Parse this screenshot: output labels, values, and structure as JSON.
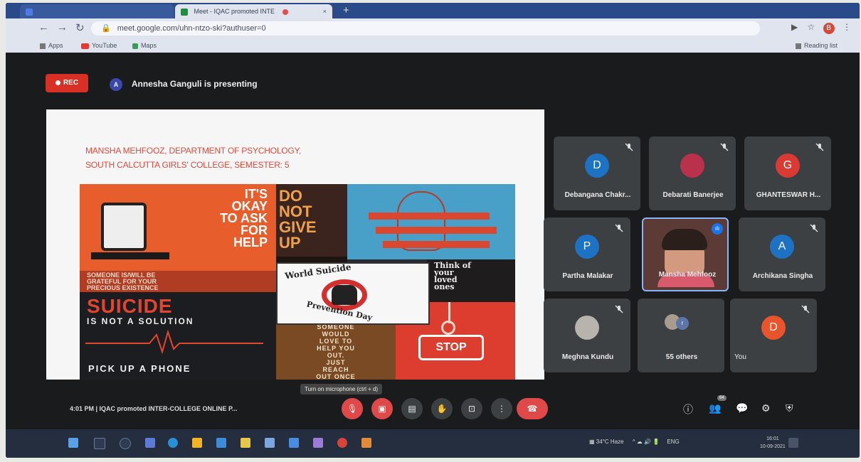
{
  "browser": {
    "tab_inactive": "",
    "tab_active": "Meet - IQAC promoted INTE",
    "url": "meet.google.com/uhn-ntzo-ski?authuser=0",
    "profile_initial": "B",
    "bookmarks": [
      "Apps",
      "YouTube",
      "Maps"
    ],
    "reading_list": "Reading list"
  },
  "meet": {
    "rec_label": "REC",
    "presenter_initial": "A",
    "presenter_text": "Annesha Ganguli is presenting",
    "slide": {
      "caption_line1": "MANSHA MEHFOOZ, DEPARTMENT OF PSYCHOLOGY,",
      "caption_line2": "SOUTH CALCUTTA GIRLS' COLLEGE, SEMESTER: 5",
      "okay_text": [
        "IT'S",
        "OKAY",
        "TO ASK",
        "FOR",
        "HELP"
      ],
      "donot_text": [
        "DO",
        "NOT",
        "GIVE",
        "UP"
      ],
      "grateful_text": [
        "SOMEONE IS/WILL BE",
        "GRATEFUL FOR YOUR",
        "PRECIOUS EXISTENCE"
      ],
      "poster_top": "World Suicide",
      "poster_bottom": "Prevention Day",
      "think_text": [
        "Think of",
        "your",
        "loved",
        "ones"
      ],
      "suicide_title": "SUICIDE",
      "suicide_sub": "IS NOT A SOLUTION",
      "pickup": "PICK UP A PHONE",
      "desert_text": [
        "SOMEONE",
        "WOULD",
        "LOVE TO",
        "HELP YOU",
        "OUT.",
        "JUST",
        "REACH",
        "OUT ONCE"
      ],
      "stop_label": "STOP"
    },
    "participants": [
      {
        "initial": "D",
        "name": "Debangana Chakr...",
        "color": "#1e72c4"
      },
      {
        "initial": "",
        "name": "Debarati Banerjee",
        "color": "#b9314a"
      },
      {
        "initial": "G",
        "name": "GHANTESWAR H...",
        "color": "#d93a33"
      },
      {
        "initial": "P",
        "name": "Partha Malakar",
        "color": "#1e72c4"
      },
      {
        "initial": "",
        "name": "Mansha Mehfooz",
        "color": "#5c3a35"
      },
      {
        "initial": "A",
        "name": "Archikana Singha",
        "color": "#1e72c4"
      },
      {
        "initial": "",
        "name": "Meghna Kundu",
        "color": "#b9b3ad"
      },
      {
        "initial": "r",
        "name": "55 others",
        "color": "#5a77a8"
      },
      {
        "initial": "D",
        "name": "You",
        "color": "#e8542c"
      }
    ],
    "bottom": {
      "time_meeting": "4:01 PM  |  IQAC promoted INTER-COLLEGE ONLINE P...",
      "tooltip": "Turn on microphone (ctrl + d)",
      "people_badge": "64"
    }
  },
  "taskbar": {
    "weather": "34°C  Haze",
    "lang": "ENG",
    "time": "16:01",
    "date": "10-09-2021"
  }
}
